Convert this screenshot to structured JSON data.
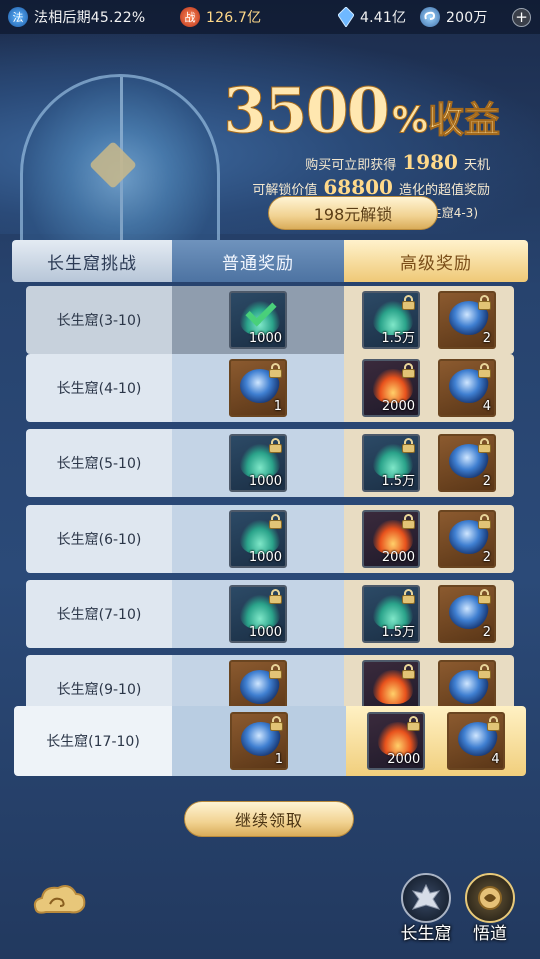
{
  "status_bar": {
    "realm": "法相后期45.22%",
    "realm_icon": "法",
    "power": "126.7亿",
    "power_icon": "战",
    "crystal": "4.41亿",
    "coin": "200万",
    "plus": "+"
  },
  "header": {
    "title_number": "3500",
    "title_suffix": "%收益",
    "line1_prefix": "购买可立即获得",
    "line1_value": "1980",
    "line1_suffix": "天机",
    "line2_prefix": "可解锁价值",
    "line2_value": "68800",
    "line2_suffix": "造化的超值奖励",
    "line3": "通过对应关卡可领取(当前长生窟4-3)",
    "unlock_button": "198元解锁"
  },
  "table": {
    "columns": [
      "长生窟挑战",
      "普通奖励",
      "高级奖励"
    ],
    "rows": [
      {
        "name": "长生窟(3-10)",
        "basic": {
          "type": "flame-green",
          "qty": "1000",
          "claimed": true
        },
        "advanced": [
          {
            "type": "flame-green",
            "qty": "1.5万"
          },
          {
            "type": "orb",
            "qty": "2"
          }
        ]
      },
      {
        "name": "长生窟(4-10)",
        "basic": {
          "type": "orb",
          "qty": "1"
        },
        "advanced": [
          {
            "type": "flame-red",
            "qty": "2000"
          },
          {
            "type": "orb",
            "qty": "4"
          }
        ]
      },
      {
        "name": "长生窟(5-10)",
        "basic": {
          "type": "flame-green",
          "qty": "1000"
        },
        "advanced": [
          {
            "type": "flame-green",
            "qty": "1.5万"
          },
          {
            "type": "orb",
            "qty": "2"
          }
        ]
      },
      {
        "name": "长生窟(6-10)",
        "basic": {
          "type": "flame-green",
          "qty": "1000"
        },
        "advanced": [
          {
            "type": "flame-red",
            "qty": "2000"
          },
          {
            "type": "orb",
            "qty": "2"
          }
        ]
      },
      {
        "name": "长生窟(7-10)",
        "basic": {
          "type": "flame-green",
          "qty": "1000"
        },
        "advanced": [
          {
            "type": "flame-green",
            "qty": "1.5万"
          },
          {
            "type": "orb",
            "qty": "2"
          }
        ]
      },
      {
        "name": "长生窟(9-10)",
        "basic": {
          "type": "orb",
          "qty": ""
        },
        "advanced": [
          {
            "type": "flame-red",
            "qty": ""
          },
          {
            "type": "orb",
            "qty": ""
          }
        ]
      },
      {
        "name": "长生窟(17-10)",
        "basic": {
          "type": "orb",
          "qty": "1"
        },
        "advanced": [
          {
            "type": "flame-red",
            "qty": "2000"
          },
          {
            "type": "orb",
            "qty": "4"
          }
        ],
        "highlight": true
      }
    ]
  },
  "footer": {
    "continue_button": "继续领取",
    "nav": [
      {
        "label": "长生窟",
        "icon": "cave-icon"
      },
      {
        "label": "悟道",
        "icon": "enlightenment-icon"
      }
    ]
  }
}
